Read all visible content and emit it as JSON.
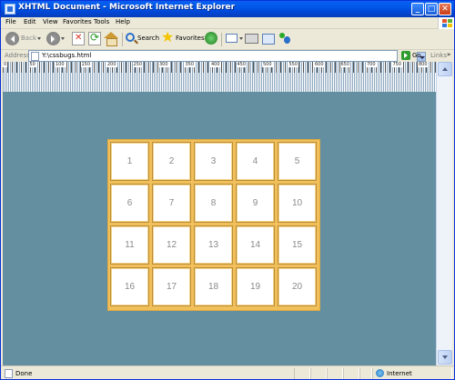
{
  "window": {
    "title": "XHTML Document - Microsoft Internet Explorer"
  },
  "menu": {
    "items": [
      "File",
      "Edit",
      "View",
      "Favorites",
      "Tools",
      "Help"
    ]
  },
  "toolbar": {
    "back_label": "Back",
    "search_label": "Search",
    "favorites_label": "Favorites"
  },
  "addressbar": {
    "label": "Address",
    "value": "Y:\\cssbugs.html",
    "go_label": "Go",
    "links_label": "Links",
    "links_chevron": "»"
  },
  "ruler": {
    "labels": [
      "0",
      "50",
      "100",
      "150",
      "200",
      "250",
      "300",
      "350",
      "400",
      "450",
      "500",
      "550",
      "600",
      "650",
      "700",
      "750",
      "800"
    ]
  },
  "grid": {
    "cells": [
      "1",
      "2",
      "3",
      "4",
      "5",
      "6",
      "7",
      "8",
      "9",
      "10",
      "11",
      "12",
      "13",
      "14",
      "15",
      "16",
      "17",
      "18",
      "19",
      "20"
    ]
  },
  "statusbar": {
    "status": "Done",
    "zone": "Internet"
  },
  "colors": {
    "content_background": "#648FA1",
    "grid_border": "#F2C05A",
    "cell_number": "#8A8A8A"
  }
}
